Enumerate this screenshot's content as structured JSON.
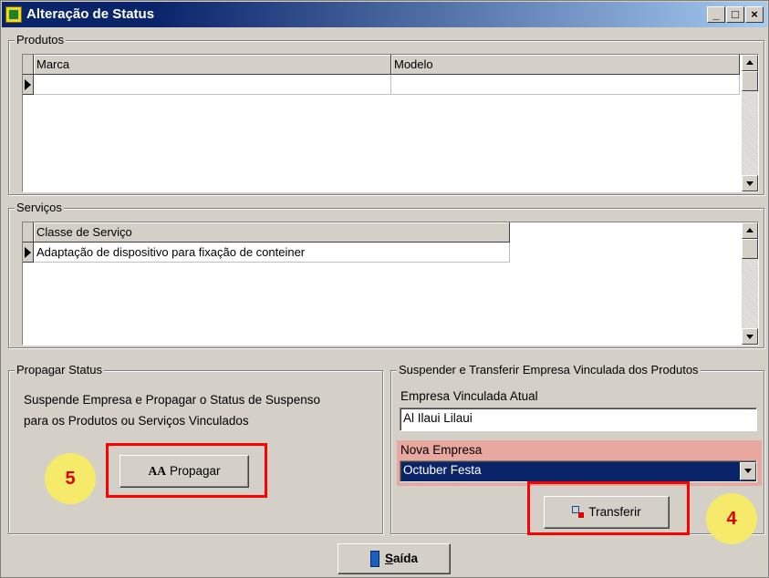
{
  "window": {
    "title": "Alteração de Status",
    "controls": {
      "minimize": "_",
      "maximize": "□",
      "close": "×"
    }
  },
  "produtos": {
    "group_label": "Produtos",
    "columns": [
      "Marca",
      "Modelo"
    ],
    "rows": [
      [
        "",
        ""
      ]
    ]
  },
  "servicos": {
    "group_label": "Serviços",
    "columns": [
      "Classe de Serviço"
    ],
    "rows": [
      [
        "Adaptação de dispositivo para fixação de conteiner"
      ]
    ]
  },
  "propagar": {
    "group_label": "Propagar Status",
    "description_line1": "Suspende Empresa e Propagar o Status de Suspenso",
    "description_line2": "para os Produtos ou Serviços Vinculados",
    "button_label": "Propagar",
    "button_icon": "AA"
  },
  "transferir": {
    "group_label": "Suspender e Transferir Empresa Vinculada dos Produtos",
    "current_label": "Empresa Vinculada Atual",
    "current_value": "Al Ilaui Lilaui",
    "new_label": "Nova Empresa",
    "new_value": "Octuber Festa",
    "button_label": "Transferir"
  },
  "footer": {
    "exit_label_prefix": "S",
    "exit_label_rest": "aída"
  },
  "annotations": {
    "badge_left": "5",
    "badge_right": "4",
    "highlight_color": "#ff0000",
    "badge_color": "#f5ea6a"
  }
}
